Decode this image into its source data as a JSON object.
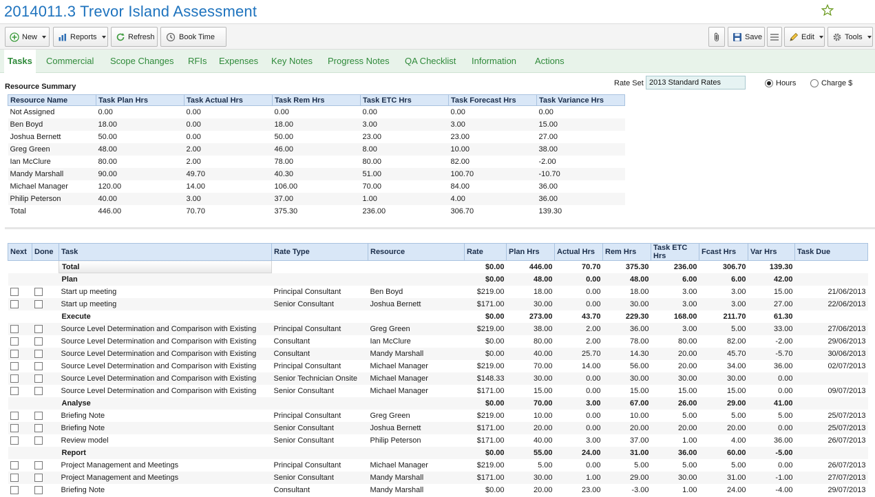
{
  "page": {
    "title": "2014011.3 Trevor Island Assessment",
    "favorite_icon": "star-outline-icon"
  },
  "toolbar": {
    "new_label": "New",
    "reports_label": "Reports",
    "refresh_label": "Refresh",
    "book_time_label": "Book Time",
    "save_label": "Save",
    "edit_label": "Edit",
    "tools_label": "Tools"
  },
  "tabs": [
    {
      "label": "Tasks"
    },
    {
      "label": "Commercial"
    },
    {
      "label": "Scope Changes"
    },
    {
      "label": "RFIs"
    },
    {
      "label": "Expenses"
    },
    {
      "label": "Key Notes"
    },
    {
      "label": "Progress Notes"
    },
    {
      "label": "QA Checklist"
    },
    {
      "label": "Information"
    },
    {
      "label": "Actions"
    }
  ],
  "resource_summary": {
    "title": "Resource Summary",
    "rate_set_label": "Rate Set",
    "rate_set_value": "2013 Standard Rates",
    "hours_label": "Hours",
    "charge_label": "Charge $",
    "columns": [
      "Resource Name",
      "Task Plan Hrs",
      "Task Actual Hrs",
      "Task Rem Hrs",
      "Task ETC Hrs",
      "Task Forecast Hrs",
      "Task Variance Hrs"
    ],
    "rows": [
      [
        "Not Assigned",
        "0.00",
        "0.00",
        "0.00",
        "0.00",
        "0.00",
        "0.00"
      ],
      [
        "Ben Boyd",
        "18.00",
        "0.00",
        "18.00",
        "3.00",
        "3.00",
        "15.00"
      ],
      [
        "Joshua Bernett",
        "50.00",
        "0.00",
        "50.00",
        "23.00",
        "23.00",
        "27.00"
      ],
      [
        "Greg Green",
        "48.00",
        "2.00",
        "46.00",
        "8.00",
        "10.00",
        "38.00"
      ],
      [
        "Ian McClure",
        "80.00",
        "2.00",
        "78.00",
        "80.00",
        "82.00",
        "-2.00"
      ],
      [
        "Mandy Marshall",
        "90.00",
        "49.70",
        "40.30",
        "51.00",
        "100.70",
        "-10.70"
      ],
      [
        "Michael Manager",
        "120.00",
        "14.00",
        "106.00",
        "70.00",
        "84.00",
        "36.00"
      ],
      [
        "Philip Peterson",
        "40.00",
        "3.00",
        "37.00",
        "1.00",
        "4.00",
        "36.00"
      ],
      [
        "Total",
        "446.00",
        "70.70",
        "375.30",
        "236.00",
        "306.70",
        "139.30"
      ]
    ]
  },
  "tasks": {
    "columns": [
      "Next",
      "Done",
      "Task",
      "Rate Type",
      "Resource",
      "Rate",
      "Plan Hrs",
      "Actual Hrs",
      "Rem Hrs",
      "Task ETC Hrs",
      "Fcast Hrs",
      "Var Hrs",
      "Task Due"
    ],
    "rows": [
      {
        "kind": "total",
        "task": "Total",
        "rate_type": "",
        "resource": "",
        "rate": "$0.00",
        "plan": "446.00",
        "actual": "70.70",
        "rem": "375.30",
        "etc": "236.00",
        "fcast": "306.70",
        "var": "139.30",
        "due": ""
      },
      {
        "kind": "group",
        "task": "Plan",
        "rate_type": "",
        "resource": "",
        "rate": "$0.00",
        "plan": "48.00",
        "actual": "0.00",
        "rem": "48.00",
        "etc": "6.00",
        "fcast": "6.00",
        "var": "42.00",
        "due": ""
      },
      {
        "kind": "task",
        "task": "Start up meeting",
        "rate_type": "Principal Consultant",
        "resource": "Ben Boyd",
        "rate": "$219.00",
        "plan": "18.00",
        "actual": "0.00",
        "rem": "18.00",
        "etc": "3.00",
        "fcast": "3.00",
        "var": "15.00",
        "due": "21/06/2013"
      },
      {
        "kind": "task",
        "task": "Start up meeting",
        "rate_type": "Senior Consultant",
        "resource": "Joshua Bernett",
        "rate": "$171.00",
        "plan": "30.00",
        "actual": "0.00",
        "rem": "30.00",
        "etc": "3.00",
        "fcast": "3.00",
        "var": "27.00",
        "due": "22/06/2013"
      },
      {
        "kind": "group",
        "task": "Execute",
        "rate_type": "",
        "resource": "",
        "rate": "$0.00",
        "plan": "273.00",
        "actual": "43.70",
        "rem": "229.30",
        "etc": "168.00",
        "fcast": "211.70",
        "var": "61.30",
        "due": ""
      },
      {
        "kind": "task",
        "task": "Source Level Determination and Comparison with Existing",
        "rate_type": "Principal Consultant",
        "resource": "Greg Green",
        "rate": "$219.00",
        "plan": "38.00",
        "actual": "2.00",
        "rem": "36.00",
        "etc": "3.00",
        "fcast": "5.00",
        "var": "33.00",
        "due": "27/06/2013"
      },
      {
        "kind": "task",
        "task": "Source Level Determination and Comparison with Existing",
        "rate_type": "Consultant",
        "resource": "Ian McClure",
        "rate": "$0.00",
        "plan": "80.00",
        "actual": "2.00",
        "rem": "78.00",
        "etc": "80.00",
        "fcast": "82.00",
        "var": "-2.00",
        "due": "29/06/2013"
      },
      {
        "kind": "task",
        "task": "Source Level Determination and Comparison with Existing",
        "rate_type": "Consultant",
        "resource": "Mandy Marshall",
        "rate": "$0.00",
        "plan": "40.00",
        "actual": "25.70",
        "rem": "14.30",
        "etc": "20.00",
        "fcast": "45.70",
        "var": "-5.70",
        "due": "30/06/2013"
      },
      {
        "kind": "task",
        "task": "Source Level Determination and Comparison with Existing",
        "rate_type": "Principal Consultant",
        "resource": "Michael Manager",
        "rate": "$219.00",
        "plan": "70.00",
        "actual": "14.00",
        "rem": "56.00",
        "etc": "20.00",
        "fcast": "34.00",
        "var": "36.00",
        "due": "02/07/2013"
      },
      {
        "kind": "task",
        "task": "Source Level Determination and Comparison with Existing",
        "rate_type": "Senior Technician Onsite",
        "resource": "Michael Manager",
        "rate": "$148.33",
        "plan": "30.00",
        "actual": "0.00",
        "rem": "30.00",
        "etc": "30.00",
        "fcast": "30.00",
        "var": "0.00",
        "due": ""
      },
      {
        "kind": "task",
        "task": "Source Level Determination and Comparison with Existing",
        "rate_type": "Senior Consultant",
        "resource": "Michael Manager",
        "rate": "$171.00",
        "plan": "15.00",
        "actual": "0.00",
        "rem": "15.00",
        "etc": "15.00",
        "fcast": "15.00",
        "var": "0.00",
        "due": "09/07/2013"
      },
      {
        "kind": "group",
        "task": "Analyse",
        "rate_type": "",
        "resource": "",
        "rate": "$0.00",
        "plan": "70.00",
        "actual": "3.00",
        "rem": "67.00",
        "etc": "26.00",
        "fcast": "29.00",
        "var": "41.00",
        "due": ""
      },
      {
        "kind": "task",
        "task": "Briefing Note",
        "rate_type": "Principal Consultant",
        "resource": "Greg Green",
        "rate": "$219.00",
        "plan": "10.00",
        "actual": "0.00",
        "rem": "10.00",
        "etc": "5.00",
        "fcast": "5.00",
        "var": "5.00",
        "due": "25/07/2013"
      },
      {
        "kind": "task",
        "task": "Briefing Note",
        "rate_type": "Senior Consultant",
        "resource": "Joshua Bernett",
        "rate": "$171.00",
        "plan": "20.00",
        "actual": "0.00",
        "rem": "20.00",
        "etc": "20.00",
        "fcast": "20.00",
        "var": "0.00",
        "due": "25/07/2013"
      },
      {
        "kind": "task",
        "task": "Review model",
        "rate_type": "Senior Consultant",
        "resource": "Philip Peterson",
        "rate": "$171.00",
        "plan": "40.00",
        "actual": "3.00",
        "rem": "37.00",
        "etc": "1.00",
        "fcast": "4.00",
        "var": "36.00",
        "due": "26/07/2013"
      },
      {
        "kind": "group",
        "task": "Report",
        "rate_type": "",
        "resource": "",
        "rate": "$0.00",
        "plan": "55.00",
        "actual": "24.00",
        "rem": "31.00",
        "etc": "36.00",
        "fcast": "60.00",
        "var": "-5.00",
        "due": ""
      },
      {
        "kind": "task",
        "task": "Project Management and Meetings",
        "rate_type": "Principal Consultant",
        "resource": "Michael Manager",
        "rate": "$219.00",
        "plan": "5.00",
        "actual": "0.00",
        "rem": "5.00",
        "etc": "5.00",
        "fcast": "5.00",
        "var": "0.00",
        "due": "26/07/2013"
      },
      {
        "kind": "task",
        "task": "Project Management and Meetings",
        "rate_type": "Senior Consultant",
        "resource": "Mandy Marshall",
        "rate": "$171.00",
        "plan": "30.00",
        "actual": "1.00",
        "rem": "29.00",
        "etc": "30.00",
        "fcast": "31.00",
        "var": "-1.00",
        "due": "27/07/2013"
      },
      {
        "kind": "task",
        "task": "Briefing Note",
        "rate_type": "Consultant",
        "resource": "Mandy Marshall",
        "rate": "$0.00",
        "plan": "20.00",
        "actual": "23.00",
        "rem": "-3.00",
        "etc": "1.00",
        "fcast": "24.00",
        "var": "-4.00",
        "due": "29/07/2013"
      }
    ]
  },
  "colors": {
    "title": "#1e73be",
    "tab_text": "#2f8a3a",
    "tab_bar_bg": "#e8f3ea",
    "table_header_bg": "#d9e7f7"
  }
}
